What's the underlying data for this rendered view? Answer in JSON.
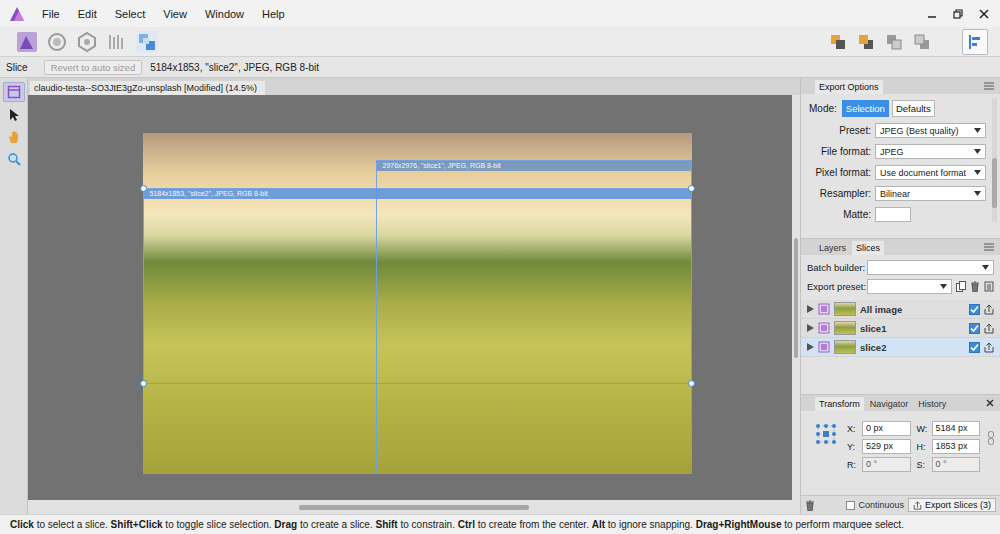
{
  "menu": [
    "File",
    "Edit",
    "Select",
    "View",
    "Window",
    "Help"
  ],
  "context_bar": {
    "tool": "Slice",
    "revert_button": {
      "label": "Revert to auto sized",
      "disabled": true
    },
    "info": "5184x1853, \"slice2\", JPEG, RGB 8-bit"
  },
  "document_tab": "claudio-testa--SO3JtE3gZo-unsplash [Modified] (14.5%)",
  "tools": [
    {
      "kind": "slice",
      "selected": true
    },
    {
      "kind": "pointer",
      "selected": false
    },
    {
      "kind": "hand",
      "selected": false
    },
    {
      "kind": "zoom",
      "selected": false
    }
  ],
  "canvas": {
    "slices": [
      {
        "label": "2976x2976, \"slice1\", JPEG, RGB 8-bit",
        "selected": false
      },
      {
        "label": "5184x1853, \"slice2\", JPEG, RGB 8-bit",
        "selected": true
      }
    ]
  },
  "export_options": {
    "title": "Export Options",
    "mode": {
      "label": "Mode:",
      "options": [
        {
          "label": "Selection",
          "selected": true
        },
        {
          "label": "Defaults",
          "selected": false
        }
      ]
    },
    "fields": [
      {
        "label": "Preset:",
        "value": "JPEG (Best quality)",
        "kind": "dropdown"
      },
      {
        "label": "File format:",
        "value": "JPEG",
        "kind": "dropdown"
      },
      {
        "label": "Pixel format:",
        "value": "Use document format",
        "kind": "dropdown"
      },
      {
        "label": "Resampler:",
        "value": "Bilinear",
        "kind": "dropdown"
      },
      {
        "label": "Matte:",
        "value": "",
        "kind": "swatch"
      }
    ]
  },
  "slices_panel": {
    "tabs": [
      {
        "label": "Layers",
        "selected": false
      },
      {
        "label": "Slices",
        "selected": true
      }
    ],
    "batch_builder": {
      "label": "Batch builder:",
      "value": ""
    },
    "export_preset": {
      "label": "Export preset:",
      "value": ""
    },
    "rows": [
      {
        "name": "All image",
        "checked": true,
        "selected": false
      },
      {
        "name": "slice1",
        "checked": true,
        "selected": false
      },
      {
        "name": "slice2",
        "checked": true,
        "selected": true
      }
    ]
  },
  "transform_panel": {
    "tabs": [
      {
        "label": "Transform",
        "selected": true
      },
      {
        "label": "Navigator",
        "selected": false
      },
      {
        "label": "History",
        "selected": false
      }
    ],
    "fields": [
      {
        "label": "X:",
        "value": "0 px"
      },
      {
        "label": "W:",
        "value": "5184 px"
      },
      {
        "label": "Y:",
        "value": "529 px"
      },
      {
        "label": "H:",
        "value": "1853 px"
      },
      {
        "label": "R:",
        "value": "0 °"
      },
      {
        "label": "S:",
        "value": "0 °"
      }
    ]
  },
  "footer": {
    "continuous": {
      "label": "Continuous",
      "checked": false
    },
    "export_button": "Export Slices (3)"
  },
  "status_bar": [
    {
      "text": "Click",
      "bold": true
    },
    {
      "text": " to select a slice. ",
      "bold": false
    },
    {
      "text": "Shift+Click",
      "bold": true
    },
    {
      "text": " to toggle slice selection. ",
      "bold": false
    },
    {
      "text": "Drag",
      "bold": true
    },
    {
      "text": " to create a slice. ",
      "bold": false
    },
    {
      "text": "Shift",
      "bold": true
    },
    {
      "text": " to constrain. ",
      "bold": false
    },
    {
      "text": "Ctrl",
      "bold": true
    },
    {
      "text": " to create from the center. ",
      "bold": false
    },
    {
      "text": "Alt",
      "bold": true
    },
    {
      "text": " to ignore snapping. ",
      "bold": false
    },
    {
      "text": "Drag+RightMouse",
      "bold": true
    },
    {
      "text": " to perform marquee select.",
      "bold": false
    }
  ]
}
